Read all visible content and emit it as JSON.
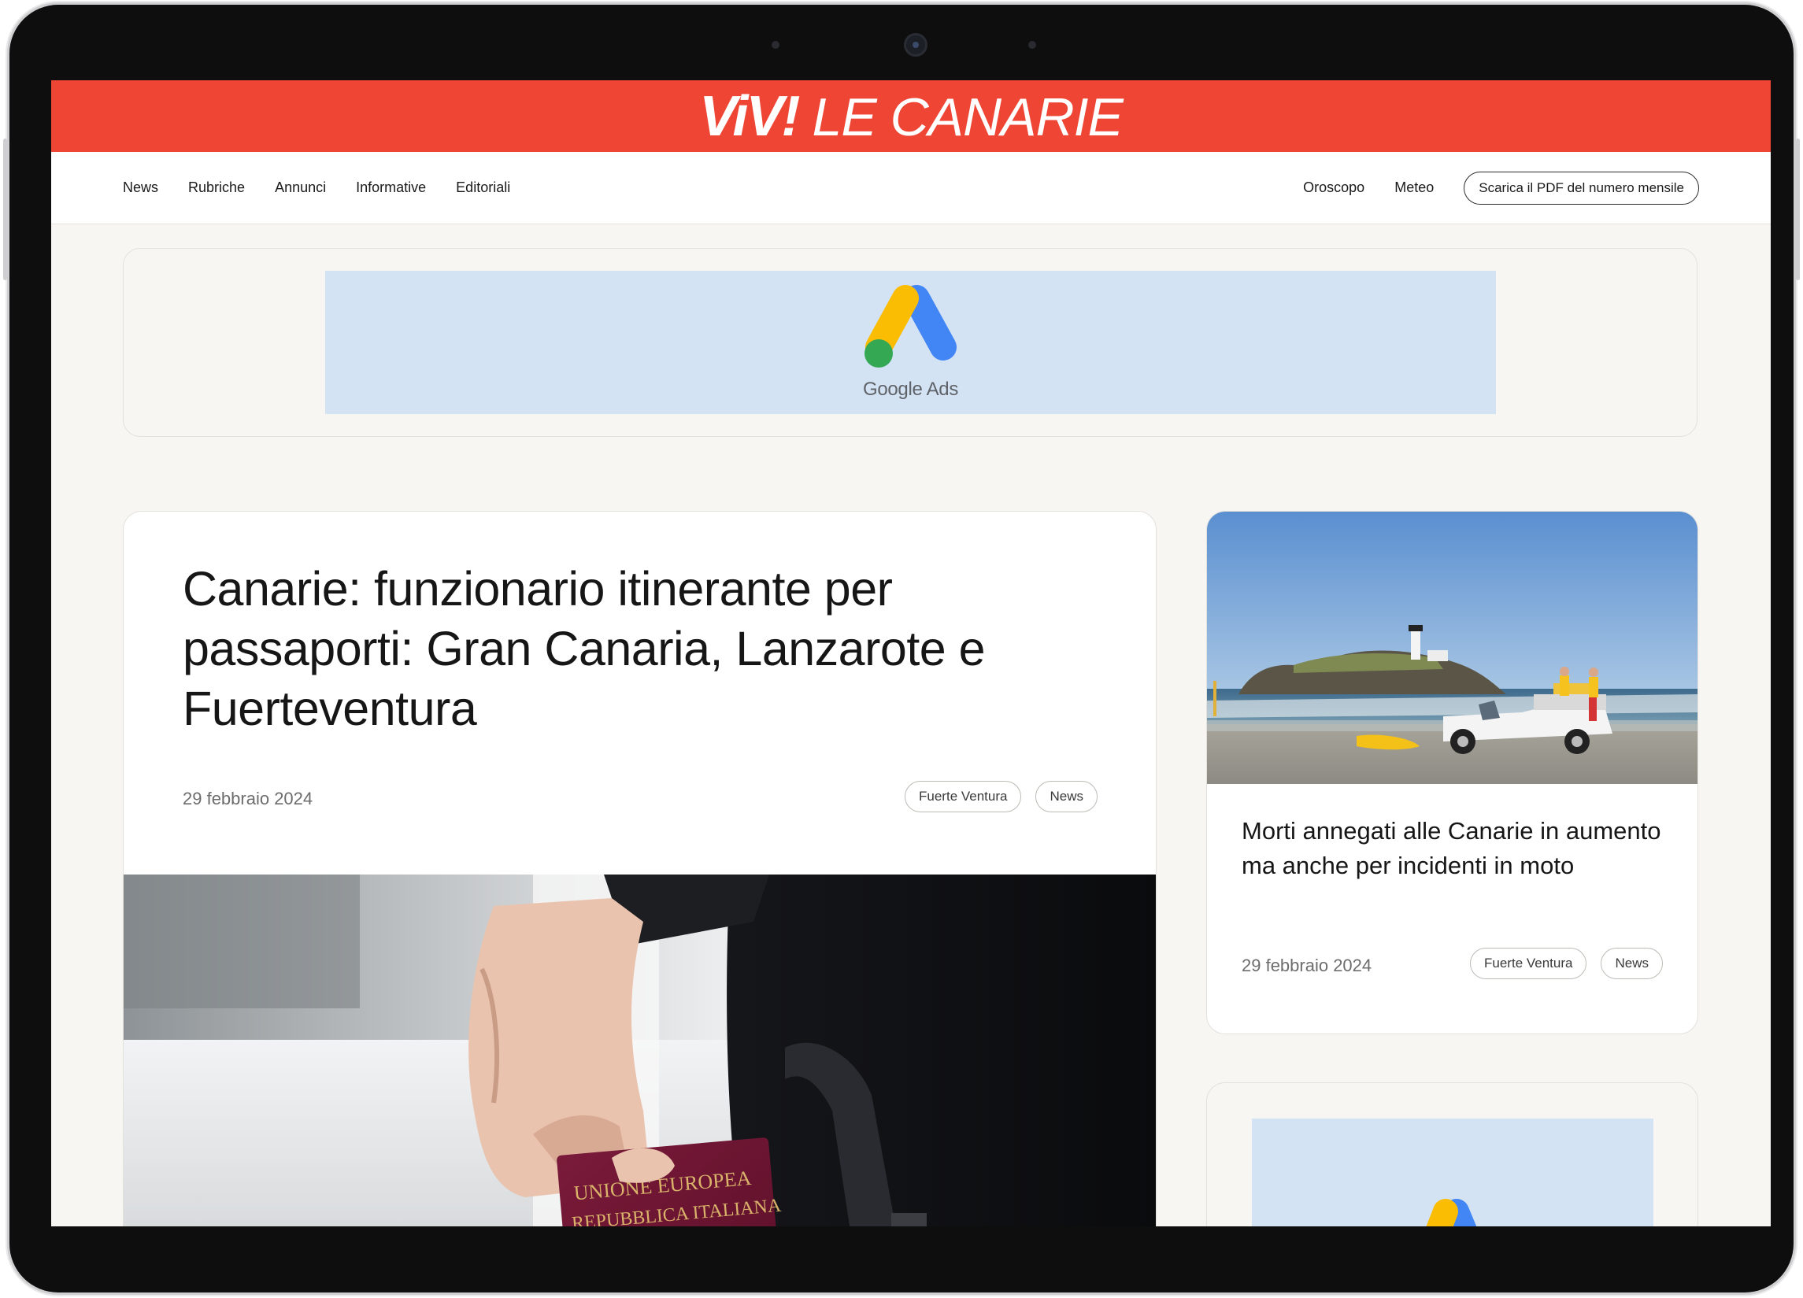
{
  "brand": {
    "logo_bold": "ViV!",
    "logo_rest": "LE CANARIE"
  },
  "nav": {
    "left": [
      "News",
      "Rubriche",
      "Annunci",
      "Informative",
      "Editoriali"
    ],
    "right": [
      "Oroscopo",
      "Meteo"
    ],
    "pdf_button": "Scarica il PDF del numero mensile"
  },
  "ad": {
    "label": "Google Ads",
    "icon": "google-ads-icon"
  },
  "main_article": {
    "title": "Canarie: funzionario itinerante per passaporti: Gran Canaria, Lanzarote e Fuerteventura",
    "date": "29 febbraio 2024",
    "tags": [
      "Fuerte Ventura",
      "News"
    ],
    "image": {
      "icon": "passport-photo",
      "passport_line1": "UNIONE EUROPEA",
      "passport_line2": "REPUBBLICA  ITALIANA"
    }
  },
  "side_article": {
    "title": "Morti annegati alle Canarie in aumento ma anche per incidenti in moto",
    "date": "29 febbraio 2024",
    "tags": [
      "Fuerte Ventura",
      "News"
    ],
    "image": {
      "icon": "beach-lifeguard-photo"
    }
  },
  "colors": {
    "brand_red": "#ef4535",
    "page_bg": "#f7f6f2",
    "ad_bg": "#d3e3f4"
  }
}
